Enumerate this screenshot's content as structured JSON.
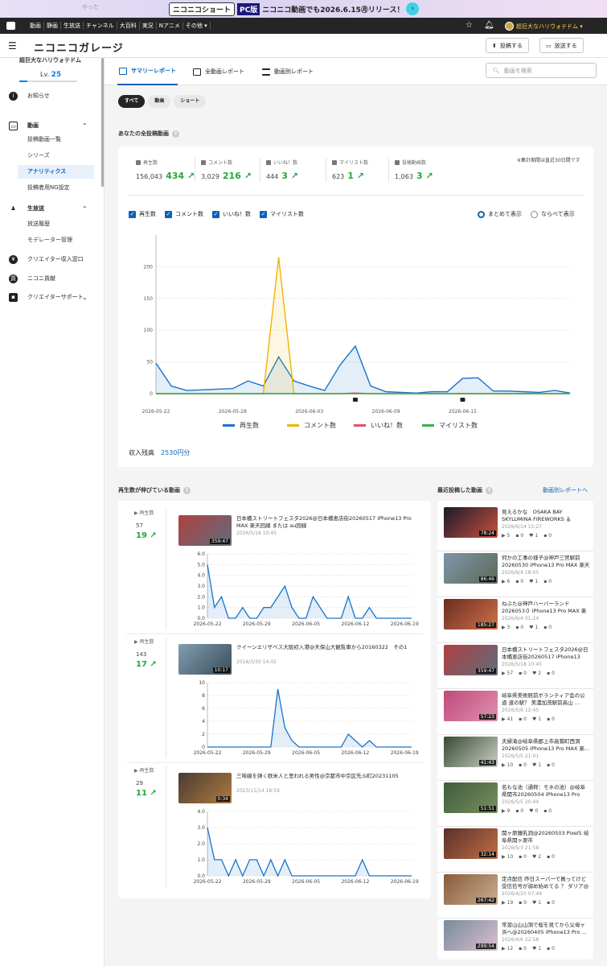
{
  "banner": {
    "logo": "ニコニコショート",
    "pc": "PC版",
    "text": "ニコニコ動画でも2026.6.15㊊リリース！",
    "arrow": "›"
  },
  "topnav": {
    "items": [
      "動画",
      "静画",
      "生放送",
      "チャンネル",
      "大百科",
      "実況",
      "Nアニメ",
      "その他 ▾"
    ],
    "user": "超巨大なハリウォテドム ▾"
  },
  "header": {
    "title": "ニコニコガレージ",
    "post_label": "投稿する",
    "live_label": "放送する"
  },
  "sidebar": {
    "user_name": "超巨大なハリウォテドム",
    "level_label": "Lv.",
    "level": "25",
    "news": "お知らせ",
    "video": "動画",
    "video_subs": [
      "投稿動画一覧",
      "シリーズ",
      "アナリティクス",
      "投稿者用NG設定"
    ],
    "live": "生放送",
    "live_subs": [
      "放送履歴",
      "モデレーター管理"
    ],
    "revenue": "クリエイター収入窓口",
    "contrib": "ニコニ貢献",
    "support": "クリエイターサポート"
  },
  "tabs": {
    "summary": "サマリーレポート",
    "all": "全動画レポート",
    "per": "動画別レポート",
    "search_placeholder": "動画を検索"
  },
  "filters": [
    "すべて",
    "動画",
    "ショート"
  ],
  "overview": {
    "title": "あなたの全投稿動画",
    "note": "※集計期間は直近30日間です",
    "stats": [
      {
        "label": "再生数",
        "total": "156,043",
        "gain": "434 ↗"
      },
      {
        "label": "コメント数",
        "total": "3,029",
        "gain": "216 ↗"
      },
      {
        "label": "いいね！数",
        "total": "444",
        "gain": "3 ↗"
      },
      {
        "label": "マイリスト数",
        "total": "623",
        "gain": "1 ↗"
      },
      {
        "label": "投稿動画数",
        "total": "1,063",
        "gain": "3 ↗"
      }
    ],
    "checks": [
      "再生数",
      "コメント数",
      "いいね！数",
      "マイリスト数"
    ],
    "radios": [
      "まとめて表示",
      "ならべて表示"
    ],
    "revenue_label": "収入残高",
    "revenue_value": "2530円分"
  },
  "chart_data": [
    {
      "type": "area",
      "title": "",
      "ylim": [
        0,
        250
      ],
      "yticks": [
        0,
        50,
        100,
        150,
        200
      ],
      "xticks": [
        "2026-05-22",
        "2026-05-28",
        "2026-06-03",
        "2026-06-09",
        "2026-06-15"
      ],
      "series": [
        {
          "name": "再生数",
          "color": "#1a73c8",
          "values": [
            48,
            12,
            5,
            6,
            7,
            8,
            20,
            12,
            58,
            20,
            12,
            5,
            45,
            75,
            12,
            3,
            2,
            1,
            3,
            3,
            24,
            25,
            4,
            4,
            3,
            2,
            5,
            1
          ]
        },
        {
          "name": "コメント数",
          "color": "#f0b400",
          "values": [
            0,
            0,
            0,
            0,
            0,
            0,
            0,
            0,
            215,
            0,
            0,
            0,
            0,
            0,
            0,
            0,
            0,
            0,
            0,
            0,
            0,
            0,
            0,
            0,
            0,
            0,
            0,
            0
          ]
        },
        {
          "name": "いいね！数",
          "color": "#e0506a",
          "values": [
            0,
            0,
            0,
            0,
            0,
            0,
            0,
            0,
            0,
            0,
            0,
            0,
            0,
            1,
            0,
            0,
            0,
            0,
            0,
            0,
            0,
            0,
            0,
            0,
            0,
            0,
            0,
            0
          ]
        },
        {
          "name": "マイリスト数",
          "color": "#37b24d",
          "values": [
            0,
            0,
            0,
            0,
            0,
            0,
            0,
            0,
            0,
            0,
            0,
            0,
            0,
            0,
            0,
            0,
            0,
            0,
            0,
            0,
            0,
            0,
            0,
            0,
            0,
            0,
            0,
            0
          ]
        }
      ]
    },
    {
      "type": "area",
      "ylim": [
        0,
        6
      ],
      "yticks": [
        "0.0",
        "1.0",
        "2.0",
        "3.0",
        "4.0",
        "5.0",
        "6.0"
      ],
      "xticks": [
        "2026-05-22",
        "2026-05-29",
        "2026-06-05",
        "2026-06-12",
        "2026-06-19"
      ],
      "series": [
        {
          "values": [
            5,
            1,
            2,
            0,
            0,
            1,
            0,
            0,
            1,
            1,
            2,
            3,
            1,
            0,
            0,
            2,
            1,
            0,
            0,
            0,
            2,
            0,
            0,
            1,
            0,
            0,
            0,
            0,
            0,
            0
          ]
        }
      ]
    },
    {
      "type": "area",
      "ylim": [
        0,
        10
      ],
      "yticks": [
        0,
        2,
        4,
        6,
        8,
        10
      ],
      "xticks": [
        "2026-05-22",
        "2026-05-29",
        "2026-06-05",
        "2026-06-12",
        "2026-06-19"
      ],
      "series": [
        {
          "values": [
            0,
            0,
            0,
            0,
            0,
            0,
            0,
            0,
            0,
            0,
            9,
            3,
            1,
            0,
            0,
            0,
            0,
            0,
            0,
            0,
            2,
            1,
            0,
            1,
            0,
            0,
            0,
            0,
            0,
            0
          ]
        }
      ]
    },
    {
      "type": "area",
      "ylim": [
        0,
        4
      ],
      "yticks": [
        "0.0",
        "1.0",
        "2.0",
        "3.0",
        "4.0"
      ],
      "xticks": [
        "2026-05-22",
        "2026-05-29",
        "2026-06-05",
        "2026-06-12",
        "2026-06-19"
      ],
      "series": [
        {
          "values": [
            3,
            1,
            1,
            0,
            1,
            0,
            1,
            1,
            0,
            1,
            0,
            1,
            0,
            0,
            0,
            0,
            0,
            0,
            0,
            0,
            0,
            0,
            1,
            0,
            0,
            0,
            0,
            0,
            0,
            0
          ]
        }
      ]
    }
  ],
  "growing": {
    "title": "再生数が伸びている動画",
    "items": [
      {
        "label": "再生数",
        "count": "57",
        "gain": "19 ↗",
        "title": "日本橋ストリートフェスタ2026@日本橋恵店街20260517 iPhone13 Pro MAX 楽天回線 または au回線",
        "date": "2026/5/18 10:45",
        "dur": "359:47",
        "thumb": [
          "#b04040",
          "#5d6d7d"
        ]
      },
      {
        "label": "再生数",
        "count": "143",
        "gain": "17 ↗",
        "title": "クイーンエリザベス大阪初入港@天保山大観覧車から20160322　その1",
        "date": "2016/3/30 14:02",
        "dur": "10:17",
        "thumb": [
          "#7f9fb0",
          "#3b4c5a"
        ]
      },
      {
        "label": "再生数",
        "count": "29",
        "gain": "11 ↗",
        "title": "三味線を弾く欧米人と思われる男性@京都市中京区先斗町20231105",
        "date": "2023/11/14 18:59",
        "dur": "0:34",
        "thumb": [
          "#4a3b32",
          "#b07a40"
        ]
      }
    ]
  },
  "recent": {
    "title": "最近投稿した動画",
    "link": "動画別レポートへ",
    "items": [
      {
        "title": "見えるかな　OSAKA BAY SKYLUMINA FIREWORKS ＆ DRONES @…",
        "date": "2026/6/14 15:27",
        "dur": "78:24",
        "counts": [
          "5",
          "0",
          "1",
          "0"
        ],
        "thumb": [
          "#1a1a2e",
          "#c8503a"
        ]
      },
      {
        "title": "何かの工事の様子@神戸三宮駅前20260530 iPhone13 Pro MAX 楽天回線 …",
        "date": "2026/6/4 18:05",
        "dur": "86:46",
        "counts": [
          "6",
          "0",
          "1",
          "0"
        ],
        "thumb": [
          "#7f96a8",
          "#5b6a58"
        ]
      },
      {
        "title": "ねぶた@神戸ハーバーランド2026053０ iPhone13 Pro MAX 楽天回線 …",
        "date": "2026/6/4 01:24",
        "dur": "185:27",
        "counts": [
          "3",
          "0",
          "1",
          "0"
        ],
        "thumb": [
          "#6a2c1f",
          "#d0724a"
        ]
      },
      {
        "title": "日本橋ストリートフェスタ2026@日本橋恵店街20260517 iPhone13 Pro …",
        "date": "2026/5/18 10:45",
        "dur": "359:47",
        "counts": [
          "57",
          "0",
          "2",
          "0"
        ],
        "thumb": [
          "#b04040",
          "#5d6d7d"
        ]
      },
      {
        "title": "岐阜県美術館前ボランティア会の公道 道の駅？ 美濃加茂駅前高山 …",
        "date": "2026/5/6 12:45",
        "dur": "57:23",
        "counts": [
          "41",
          "0",
          "1",
          "0"
        ],
        "thumb": [
          "#c04a7a",
          "#e090b0"
        ]
      },
      {
        "title": "夫婦滝@岐阜県郡上市高鷲町西洞　20260505 iPhone13 Pro MAX 楽…",
        "date": "2026/5/5 21:01",
        "dur": "41:43",
        "counts": [
          "10",
          "0",
          "1",
          "0"
        ],
        "thumb": [
          "#3a4a30",
          "#c8d0c8"
        ]
      },
      {
        "title": "名もな池（通称：モネの池）@岐阜県関市20260504 iPhone13 Pro MAX …",
        "date": "2026/5/5 20:44",
        "dur": "51:51",
        "counts": [
          "9",
          "0",
          "0",
          "0"
        ],
        "thumb": [
          "#3d5c3a",
          "#7a9060"
        ]
      },
      {
        "title": "関ヶ原鍾乳洞@20260503 Pixel5 岐阜県関ヶ原市",
        "date": "2026/5/3 21:58",
        "dur": "32:14",
        "counts": [
          "10",
          "0",
          "2",
          "0"
        ],
        "thumb": [
          "#5a3028",
          "#c07048"
        ]
      },
      {
        "title": "定点配信 昨日スーパーで買ってけど受信信号が弱め始めてる ？ ダリア@ベラ…",
        "date": "2026/4/20 07:49",
        "dur": "267:42",
        "counts": [
          "19",
          "0",
          "1",
          "0"
        ],
        "thumb": [
          "#8a5a3a",
          "#c8b090"
        ]
      },
      {
        "title": "常習山山山頂で桜を見てから父母ヶ浜へ@20260405 iPhone13 Pro …",
        "date": "2026/4/6 22:58",
        "dur": "299:54",
        "counts": [
          "12",
          "0",
          "1",
          "0"
        ],
        "thumb": [
          "#7a8a9a",
          "#d8c0d0"
        ]
      }
    ]
  }
}
